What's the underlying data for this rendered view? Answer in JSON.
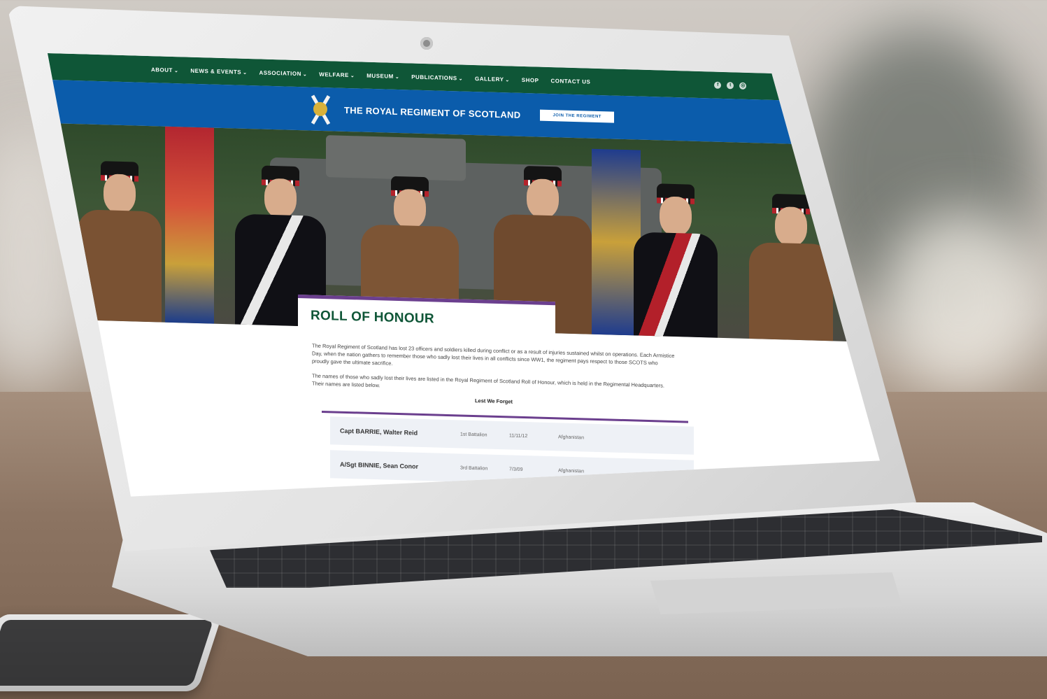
{
  "nav": {
    "items": [
      {
        "label": "ABOUT",
        "dropdown": true
      },
      {
        "label": "NEWS & EVENTS",
        "dropdown": true
      },
      {
        "label": "ASSOCIATION",
        "dropdown": true
      },
      {
        "label": "WELFARE",
        "dropdown": true
      },
      {
        "label": "MUSEUM",
        "dropdown": true
      },
      {
        "label": "PUBLICATIONS",
        "dropdown": true
      },
      {
        "label": "GALLERY",
        "dropdown": true
      },
      {
        "label": "SHOP",
        "dropdown": false
      },
      {
        "label": "CONTACT US",
        "dropdown": false
      }
    ],
    "social": [
      "facebook-icon",
      "twitter-icon",
      "instagram-icon"
    ]
  },
  "brand": {
    "name": "THE ROYAL REGIMENT OF SCOTLAND",
    "join_button": "JOIN THE REGIMENT"
  },
  "page": {
    "title": "ROLL OF HONOUR",
    "paragraph1": "The Royal Regiment of Scotland has lost 23 officers and soldiers killed during conflict or as a result of injuries sustained whilst on operations. Each Armistice Day, when the nation gathers to remember those who sadly lost their lives in all conflicts since WW1, the regiment pays respect to those SCOTS who proudly gave the ultimate sacrifice.",
    "paragraph2": "The names of those who sadly lost their lives are listed in the Royal Regiment of Scotland Roll of Honour, which is held in the Regimental Headquarters. Their names are listed below.",
    "lest_we_forget": "Lest We Forget"
  },
  "roll": [
    {
      "name": "Capt BARRIE, Walter Reid",
      "battalion": "1st Battalion",
      "date": "11/11/12",
      "theatre": "Afghanistan"
    },
    {
      "name": "A/Sgt BINNIE, Sean Conor",
      "battalion": "3rd Battalion",
      "date": "7/3/09",
      "theatre": "Afghanistan"
    }
  ],
  "colors": {
    "nav_green": "#0f5637",
    "brand_blue": "#0b5cab",
    "accent_purple": "#6b3f8e"
  }
}
